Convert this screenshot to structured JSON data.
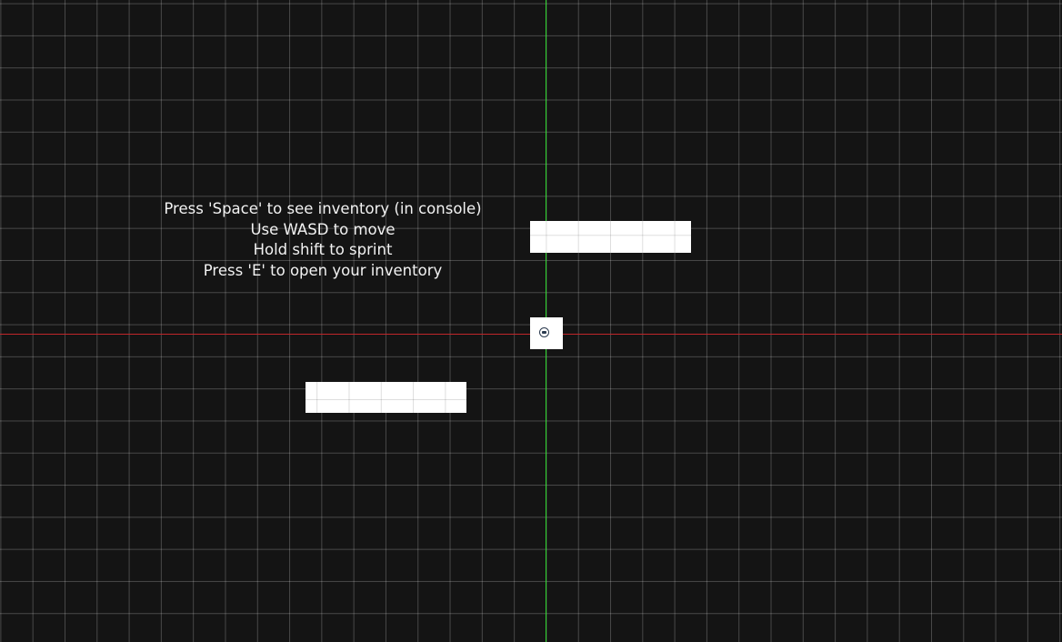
{
  "scene": {
    "background_color": "#141414",
    "grid_color": "#ffffff",
    "y_axis_color": "#2fd62f",
    "x_axis_color": "#c0262a",
    "block_color": "#ffffff"
  },
  "instructions": {
    "lines": [
      "Press 'Space' to see inventory (in console)",
      "Use WASD to move",
      "Hold shift to sprint",
      "Press 'E' to open your inventory"
    ]
  },
  "player": {
    "icon": "player-avatar-icon"
  }
}
